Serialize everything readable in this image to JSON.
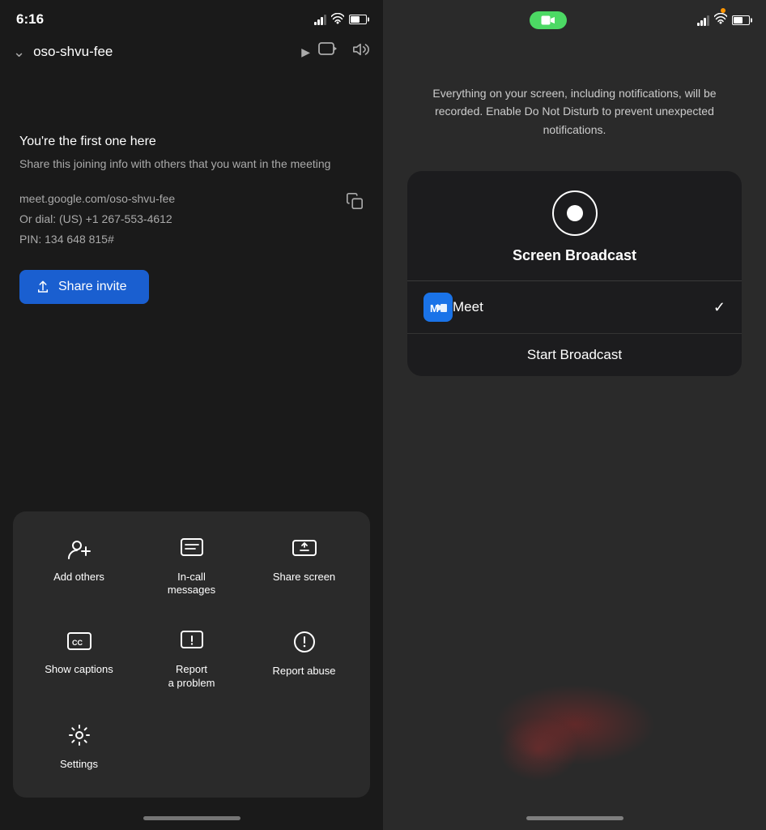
{
  "left": {
    "statusBar": {
      "time": "6:16"
    },
    "header": {
      "meetingName": "oso-shvu-fee",
      "chevron": "▾",
      "cameraIcon": "⬛",
      "speakerIcon": "🔈"
    },
    "meetingInfo": {
      "headline": "You're the first one here",
      "description": "Share this joining info with others that you want in the meeting",
      "link": "meet.google.com/oso-shvu-fee",
      "dialInfo": "Or dial: (US) +1 267-553-4612",
      "pin": "PIN: 134 648 815#"
    },
    "shareInvite": {
      "label": "Share invite"
    },
    "menu": {
      "items": [
        {
          "icon": "👥+",
          "label": "Add others"
        },
        {
          "icon": "💬",
          "label": "In-call\nmessages"
        },
        {
          "icon": "📤",
          "label": "Share screen"
        },
        {
          "icon": "CC",
          "label": "Show captions"
        },
        {
          "icon": "⚠",
          "label": "Report\na problem"
        },
        {
          "icon": "🚫",
          "label": "Report abuse"
        },
        {
          "icon": "⚙",
          "label": "Settings"
        }
      ]
    }
  },
  "right": {
    "broadcastInfo": "Everything on your screen, including notifications, will be recorded. Enable Do Not Disturb to prevent unexpected notifications.",
    "broadcastCard": {
      "title": "Screen Broadcast",
      "meetLabel": "Meet",
      "startBroadcast": "Start Broadcast"
    }
  }
}
